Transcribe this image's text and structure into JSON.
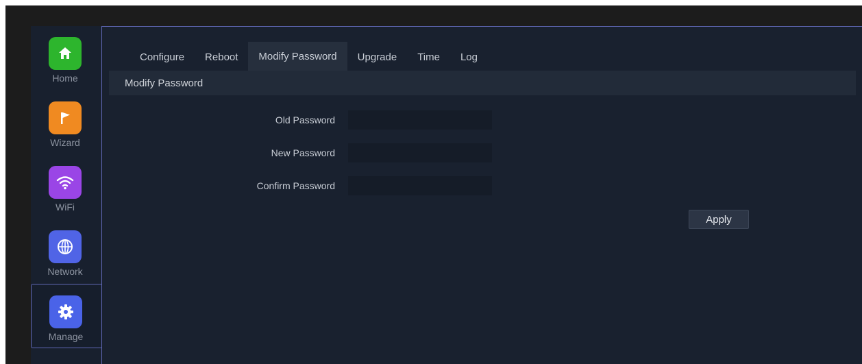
{
  "sidebar": {
    "items": [
      {
        "label": "Home",
        "icon": "home-icon",
        "color": "#2db52d"
      },
      {
        "label": "Wizard",
        "icon": "flag-icon",
        "color": "#f08a21"
      },
      {
        "label": "WiFi",
        "icon": "wifi-icon",
        "color": "#9a45e6"
      },
      {
        "label": "Network",
        "icon": "globe-icon",
        "color": "#5064e6"
      },
      {
        "label": "Manage",
        "icon": "gear-icon",
        "color": "#4a63e8"
      }
    ],
    "active": "Manage"
  },
  "tabs": [
    {
      "label": "Configure"
    },
    {
      "label": "Reboot"
    },
    {
      "label": "Modify Password"
    },
    {
      "label": "Upgrade"
    },
    {
      "label": "Time"
    },
    {
      "label": "Log"
    }
  ],
  "active_tab": "Modify Password",
  "section": {
    "title": "Modify Password"
  },
  "form": {
    "old_password": {
      "label": "Old Password",
      "value": ""
    },
    "new_password": {
      "label": "New Password",
      "value": ""
    },
    "confirm_password": {
      "label": "Confirm Password",
      "value": ""
    },
    "apply_label": "Apply"
  },
  "colors": {
    "accent_border": "#6169b7",
    "active_tab_underline": "#b8773a",
    "panel_bg": "#19212f"
  }
}
